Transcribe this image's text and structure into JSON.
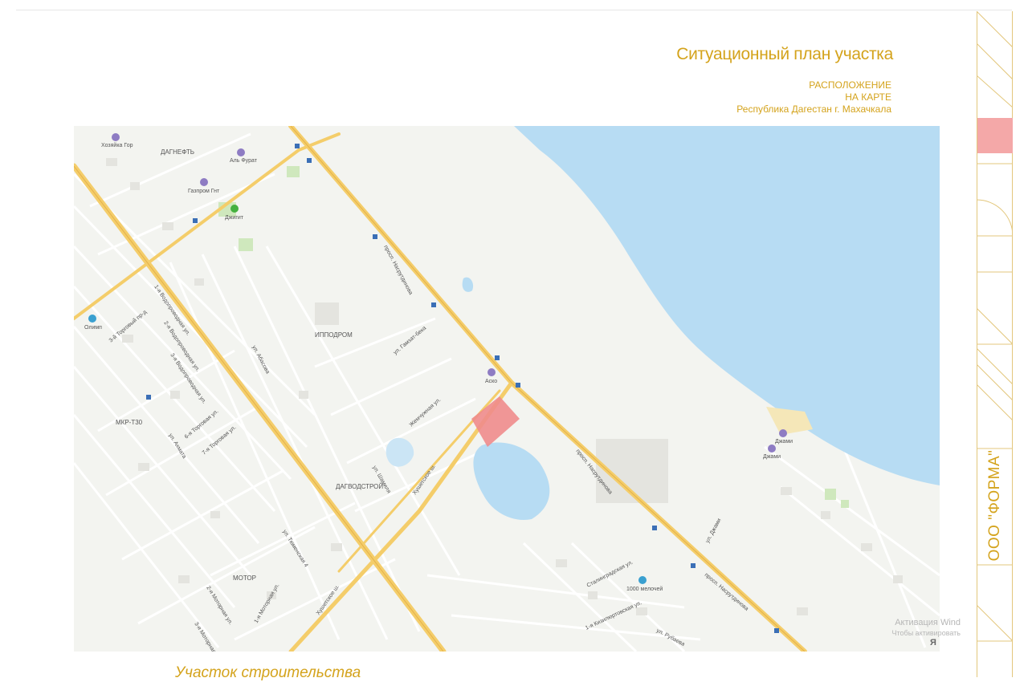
{
  "header": {
    "title": "Ситуационный план участка",
    "location_line1": "РАСПОЛОЖЕНИЕ",
    "location_line2": "НА КАРТЕ",
    "location_line3": "Республика Дагестан г. Махачкала"
  },
  "map": {
    "colors": {
      "sea": "#b7dcf3",
      "land": "#f3f4f0",
      "major_road": "#f4cd6a",
      "minor_road": "#ffffff",
      "site": "#f08c8c",
      "green": "#bde3a8"
    },
    "site_label": "Участок строительства",
    "districts": [
      "ДАГНЕФТЬ",
      "ИППОДРОМ",
      "МКР-Т30",
      "ДАГВОДСТРОЙ",
      "МОТОР"
    ],
    "pois": [
      "Хозяйка Гор",
      "Аль Фурат",
      "Газпром Гнт",
      "Джигит",
      "Олимп",
      "Аско",
      "Джами",
      "Джами",
      "1000 мелочей"
    ],
    "streets": [
      "просп. Насрутдинова",
      "просп. Насрутдинова",
      "просп. Насрутдинова",
      "Хушетское ш.",
      "Хушетское ш.",
      "ул. Шамиля",
      "ул. Ахмата",
      "ул. Абасова",
      "ул. Гамзат-бека",
      "Жемчужная ул.",
      "ул. Джами",
      "ул. Рубаева",
      "Сталинградская ул.",
      "1-я Кизилюртовская ул.",
      "ул. Тюменская 4",
      "1-я Водопроводная ул.",
      "2-я Водопроводная ул.",
      "3-я Водопроводная ул.",
      "6-я Торговая ул.",
      "7-я Торговая ул.",
      "3-й Торговый пр-д",
      "1-я Моторная ул.",
      "2-я Моторная ул.",
      "3-я Моторная ул."
    ]
  },
  "watermark": {
    "line1": "Активация Wind",
    "line2": "Чтобы активировать"
  },
  "caption": "Участок строительства",
  "sidebar": {
    "company": "ООО \"ФОРМА\""
  }
}
